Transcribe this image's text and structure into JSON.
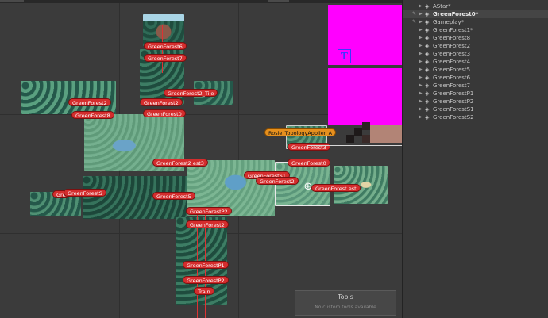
{
  "scene_labels": {
    "gf6": "GreenForest6",
    "gf7": "GreenForest7",
    "gf2a": "GreenForest2",
    "gf2b": "GreenForest2",
    "gf2_tile": "GreenForest2_Tile",
    "gf8": "GreenForest8",
    "gf0": "GreenForest0",
    "gf2c": "GreenForest2",
    "gf3": "GreenForest3",
    "gf10": "GreenForest0",
    "gf_2st": "GreenForest2 est3",
    "gfs1": "GreenForestS1",
    "gf2d": "GreenForest2",
    "gf2e": "GreenForest2",
    "gf_est": "GreenForest est",
    "gfs": "GreenForestS",
    "gf2_5": "GreenForest5",
    "gfp2": "GreenForestP2",
    "gf2f": "GreenForest2",
    "gfp1": "GreenForestP1",
    "gfp_2": "GreenForestP2",
    "train": "Train",
    "gre": "Gre",
    "rosie": "Rosie_TopologyApplier_A"
  },
  "tools_panel": {
    "title": "Tools",
    "subtitle": "No custom tools available"
  },
  "hierarchy": [
    {
      "name": "AStar*",
      "bold": false,
      "lead": ""
    },
    {
      "name": "GreenForest0*",
      "bold": true,
      "lead": "eye"
    },
    {
      "name": "Gameplay*",
      "bold": false,
      "lead": "eye"
    },
    {
      "name": "GreenForest1*",
      "bold": false,
      "lead": ""
    },
    {
      "name": "GreenForest8",
      "bold": false,
      "lead": ""
    },
    {
      "name": "GreenForest2",
      "bold": false,
      "lead": ""
    },
    {
      "name": "GreenForest3",
      "bold": false,
      "lead": ""
    },
    {
      "name": "GreenForest4",
      "bold": false,
      "lead": ""
    },
    {
      "name": "GreenForest5",
      "bold": false,
      "lead": ""
    },
    {
      "name": "GreenForest6",
      "bold": false,
      "lead": ""
    },
    {
      "name": "GreenForest7",
      "bold": false,
      "lead": ""
    },
    {
      "name": "GreenForestP1",
      "bold": false,
      "lead": ""
    },
    {
      "name": "GreenForestP2",
      "bold": false,
      "lead": ""
    },
    {
      "name": "GreenForestS1",
      "bold": false,
      "lead": ""
    },
    {
      "name": "GreenForestS2",
      "bold": false,
      "lead": ""
    }
  ],
  "icons": {
    "text_gizmo": "T",
    "globe": "⊕",
    "arrow": "▶",
    "unity": "◈"
  },
  "colors": {
    "label_red": "#d42d2d",
    "label_orange": "#e6901e",
    "magenta": "#ff00ff",
    "forest": "#2f6b57",
    "grass": "#6fa886"
  }
}
